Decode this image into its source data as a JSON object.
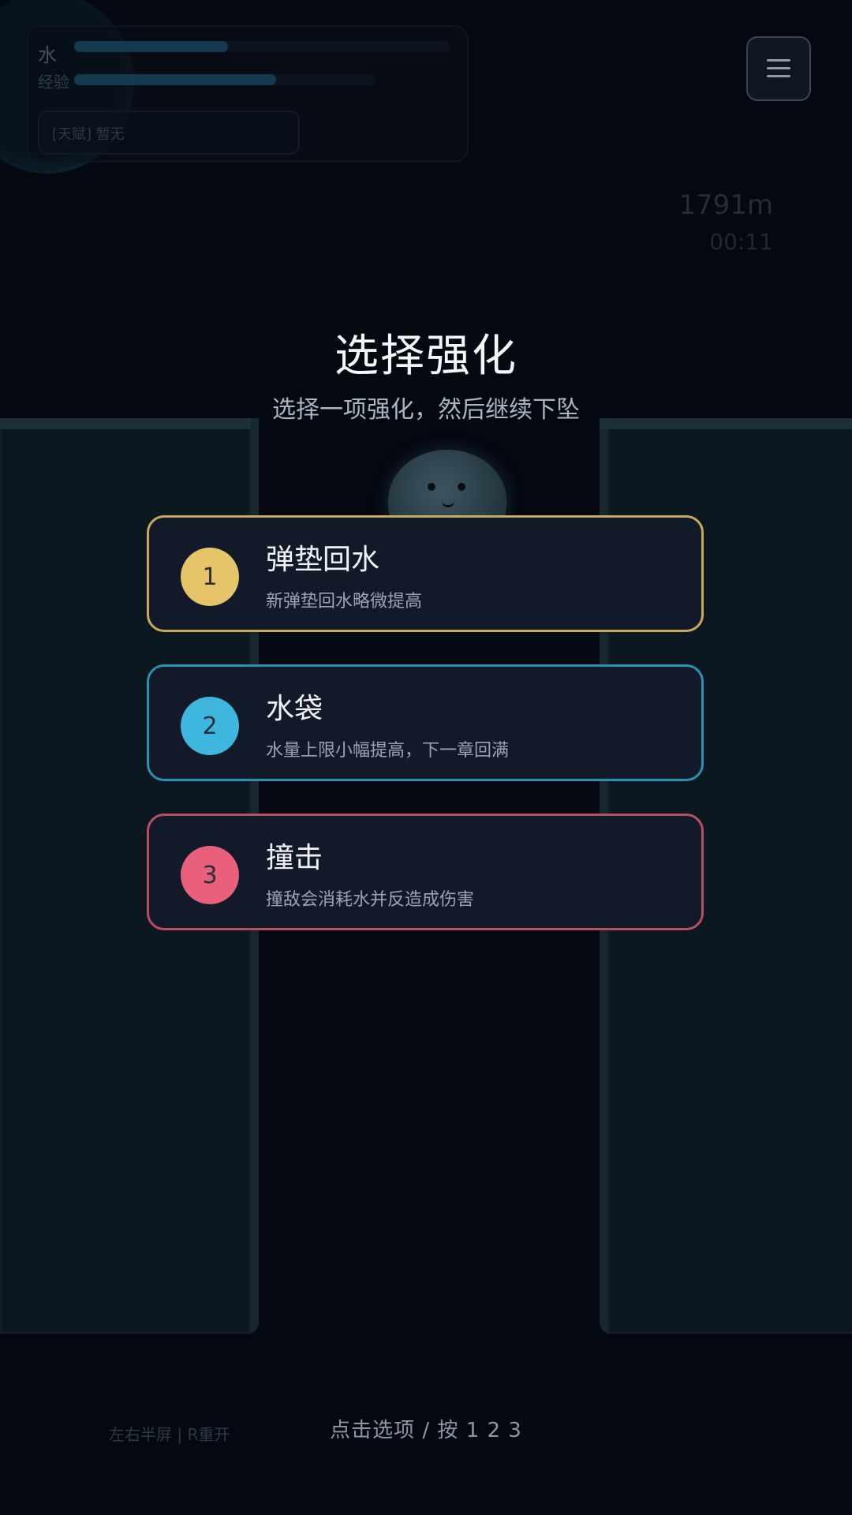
{
  "hud": {
    "water_label": "水",
    "exp_label": "经验",
    "water_level": 0.41,
    "exp_level": 0.67,
    "talent_text": "[天赋] 暂无",
    "distance": "1791m",
    "timer": "00:11",
    "menu_icon": "hamburger-menu-icon"
  },
  "overlay": {
    "title": "选择强化",
    "subtitle": "选择一项强化，然后继续下坠"
  },
  "options": [
    {
      "number": "1",
      "name": "弹垫回水",
      "desc": "新弹垫回水略微提高",
      "color": "#e5c46a",
      "border": "#c8a95a"
    },
    {
      "number": "2",
      "name": "水袋",
      "desc": "水量上限小幅提高，下一章回满",
      "color": "#3fb6e0",
      "border": "#2f8fb0"
    },
    {
      "number": "3",
      "name": "撞击",
      "desc": "撞敌会消耗水并反造成伤害",
      "color": "#e8607a",
      "border": "#b84e62"
    }
  ],
  "footer": {
    "hint": "点击选项 / 按 1 2 3",
    "controls": "左右半屏 | R重开"
  }
}
